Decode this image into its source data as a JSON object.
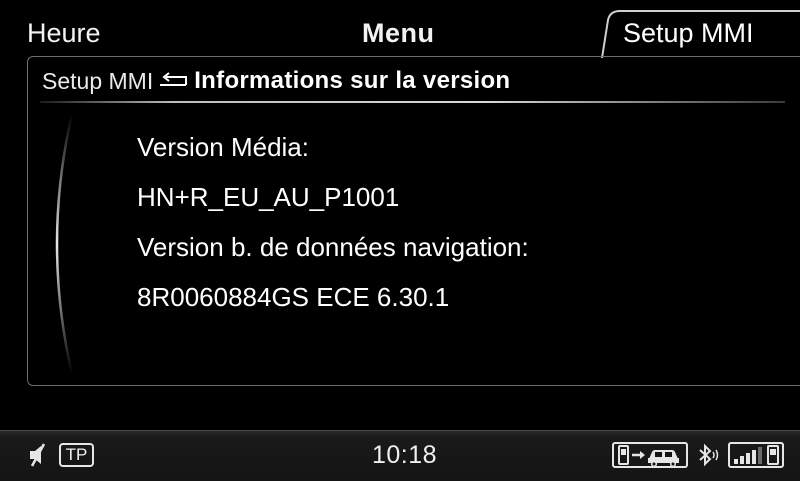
{
  "tabs": {
    "left_label": "Heure",
    "center_label": "Menu",
    "active_label": "Setup MMI"
  },
  "breadcrumb": {
    "parent": "Setup MMI",
    "back_icon": "back-arrow-icon",
    "title": "Informations sur la version"
  },
  "info": {
    "media_label": "Version Média:",
    "media_value": "HN+R_EU_AU_P1001",
    "nav_label": "Version b. de données navigation:",
    "nav_value": "8R0060884GS ECE 6.30.1"
  },
  "status_bar": {
    "mute_icon": "speaker-muted-icon",
    "tp_label": "TP",
    "time": "10:18",
    "phone_car_icon": "phone-to-car-icon",
    "bluetooth_icon": "bluetooth-icon",
    "signal_icon": "signal-strength-icon",
    "signal_bars": 4
  },
  "colors": {
    "background": "#000000",
    "text": "#ffffff",
    "border": "#6e6e6e"
  }
}
